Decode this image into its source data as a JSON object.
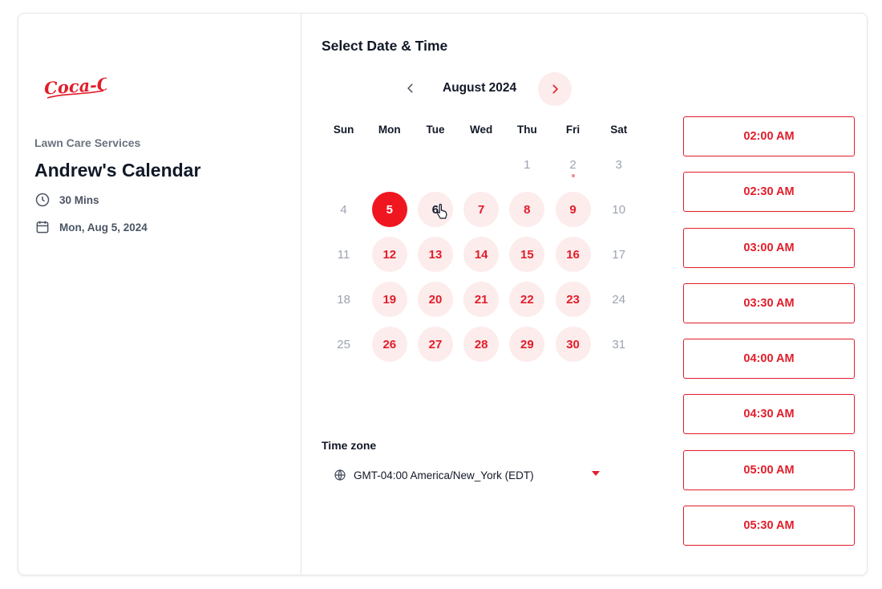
{
  "left": {
    "logo_text": "Coca-Cola",
    "organization": "Lawn Care Services",
    "calendar_title": "Andrew's Calendar",
    "duration": "30 Mins",
    "selected_date": "Mon, Aug 5, 2024"
  },
  "right": {
    "section_title": "Select Date & Time",
    "month_label": "August 2024",
    "weekdays": [
      "Sun",
      "Mon",
      "Tue",
      "Wed",
      "Thu",
      "Fri",
      "Sat"
    ],
    "days": [
      {
        "n": "",
        "state": "empty"
      },
      {
        "n": "",
        "state": "empty"
      },
      {
        "n": "",
        "state": "empty"
      },
      {
        "n": "",
        "state": "empty"
      },
      {
        "n": "1",
        "state": "disabled"
      },
      {
        "n": "2",
        "state": "disabled-today"
      },
      {
        "n": "3",
        "state": "disabled"
      },
      {
        "n": "4",
        "state": "disabled"
      },
      {
        "n": "5",
        "state": "selected"
      },
      {
        "n": "6",
        "state": "hover"
      },
      {
        "n": "7",
        "state": "available"
      },
      {
        "n": "8",
        "state": "available"
      },
      {
        "n": "9",
        "state": "available"
      },
      {
        "n": "10",
        "state": "disabled"
      },
      {
        "n": "11",
        "state": "disabled"
      },
      {
        "n": "12",
        "state": "available"
      },
      {
        "n": "13",
        "state": "available"
      },
      {
        "n": "14",
        "state": "available"
      },
      {
        "n": "15",
        "state": "available"
      },
      {
        "n": "16",
        "state": "available"
      },
      {
        "n": "17",
        "state": "disabled"
      },
      {
        "n": "18",
        "state": "disabled"
      },
      {
        "n": "19",
        "state": "available"
      },
      {
        "n": "20",
        "state": "available"
      },
      {
        "n": "21",
        "state": "available"
      },
      {
        "n": "22",
        "state": "available"
      },
      {
        "n": "23",
        "state": "available"
      },
      {
        "n": "24",
        "state": "disabled"
      },
      {
        "n": "25",
        "state": "disabled"
      },
      {
        "n": "26",
        "state": "available"
      },
      {
        "n": "27",
        "state": "available"
      },
      {
        "n": "28",
        "state": "available"
      },
      {
        "n": "29",
        "state": "available"
      },
      {
        "n": "30",
        "state": "available"
      },
      {
        "n": "31",
        "state": "disabled"
      }
    ],
    "timezone_label": "Time zone",
    "timezone_value": "GMT-04:00 America/New_York (EDT)",
    "time_slots": [
      "02:00 AM",
      "02:30 AM",
      "03:00 AM",
      "03:30 AM",
      "04:00 AM",
      "04:30 AM",
      "05:00 AM",
      "05:30 AM"
    ]
  },
  "icons": {
    "prev": "chevron-left-icon",
    "next": "chevron-right-icon",
    "duration": "clock-icon",
    "date": "calendar-icon",
    "timezone": "globe-icon",
    "dropdown": "caret-down-icon",
    "cursor": "hand-pointer-icon"
  },
  "colors": {
    "accent": "#e11d2a",
    "selected_fill": "#f0161f",
    "available_fill": "#fdecec",
    "muted_text": "#9ca3af",
    "today_dot": "#f08a8f"
  }
}
